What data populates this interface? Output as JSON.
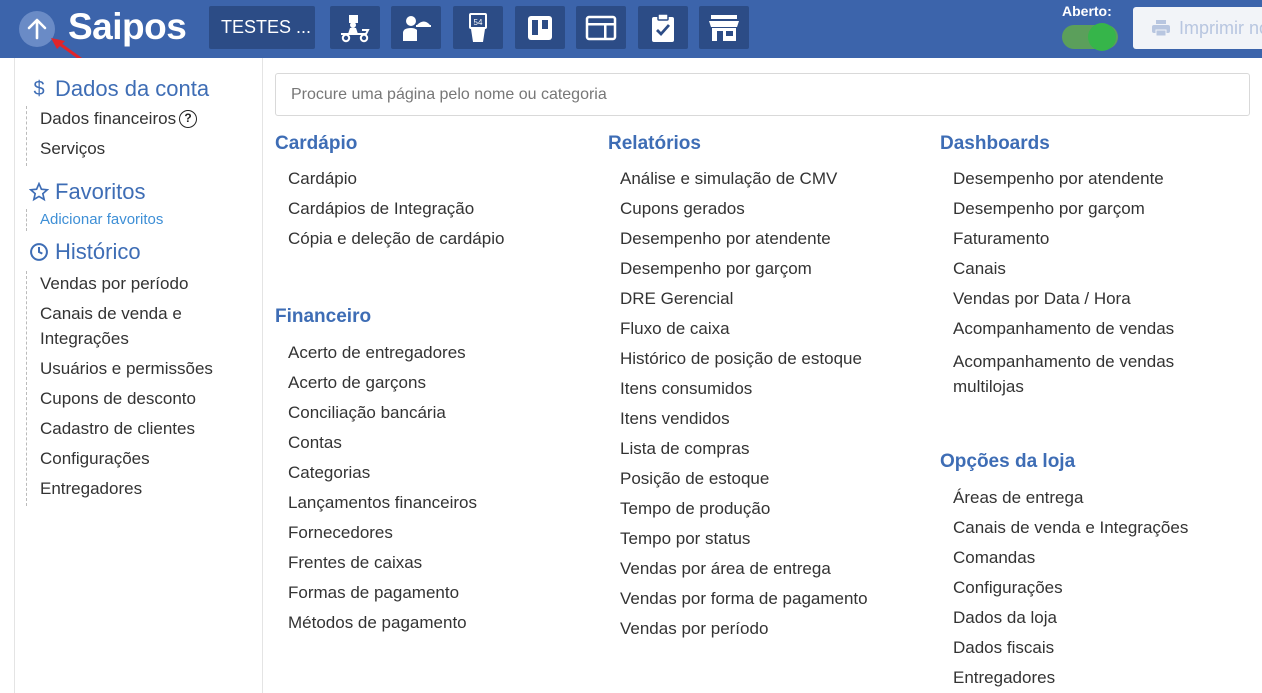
{
  "header": {
    "logo_text": "Saipos",
    "store_name": "TESTES ...",
    "toolbar_icons": [
      "delivery-scooter-icon",
      "waiter-icon",
      "table-number-icon",
      "kanban-board-icon",
      "card-display-icon",
      "checklist-icon",
      "storefront-icon"
    ],
    "open_label": "Aberto:",
    "print_label": "Imprimir no",
    "colors": {
      "topbar": "#3c64ab",
      "button": "#2c4c86",
      "toggle_on": "#36b54a",
      "accent": "#3e6db5"
    }
  },
  "sidebar": {
    "account": {
      "title": "Dados da conta",
      "items": [
        "Dados financeiros",
        "Serviços"
      ]
    },
    "favorites": {
      "title": "Favoritos",
      "add_link": "Adicionar favoritos"
    },
    "history": {
      "title": "Histórico",
      "items": [
        "Vendas por período",
        "Canais de venda e Integrações",
        "Usuários e permissões",
        "Cupons de desconto",
        "Cadastro de clientes",
        "Configurações",
        "Entregadores"
      ]
    }
  },
  "search": {
    "placeholder": "Procure uma página pelo nome ou categoria"
  },
  "categories": {
    "cardapio": {
      "title": "Cardápio",
      "items": [
        "Cardápio",
        "Cardápios de Integração",
        "Cópia e deleção de cardápio"
      ]
    },
    "financeiro": {
      "title": "Financeiro",
      "items": [
        "Acerto de entregadores",
        "Acerto de garçons",
        "Conciliação bancária",
        "Contas",
        "Categorias",
        "Lançamentos financeiros",
        "Fornecedores",
        "Frentes de caixas",
        "Formas de pagamento",
        "Métodos de pagamento"
      ]
    },
    "relatorios": {
      "title": "Relatórios",
      "items": [
        "Análise e simulação de CMV",
        "Cupons gerados",
        "Desempenho por atendente",
        "Desempenho por garçom",
        "DRE Gerencial",
        "Fluxo de caixa",
        "Histórico de posição de estoque",
        "Itens consumidos",
        "Itens vendidos",
        "Lista de compras",
        "Posição de estoque",
        "Tempo de produção",
        "Tempo por status",
        "Vendas por área de entrega",
        "Vendas por forma de pagamento",
        "Vendas por período"
      ]
    },
    "dashboards": {
      "title": "Dashboards",
      "items": [
        "Desempenho por atendente",
        "Desempenho por garçom",
        "Faturamento",
        "Canais",
        "Vendas por Data / Hora",
        "Acompanhamento de vendas",
        "Acompanhamento de vendas multilojas"
      ]
    },
    "opcoes_loja": {
      "title": "Opções da loja",
      "items": [
        "Áreas de entrega",
        "Canais de venda e Integrações",
        "Comandas",
        "Configurações",
        "Dados da loja",
        "Dados fiscais",
        "Entregadores"
      ]
    }
  }
}
